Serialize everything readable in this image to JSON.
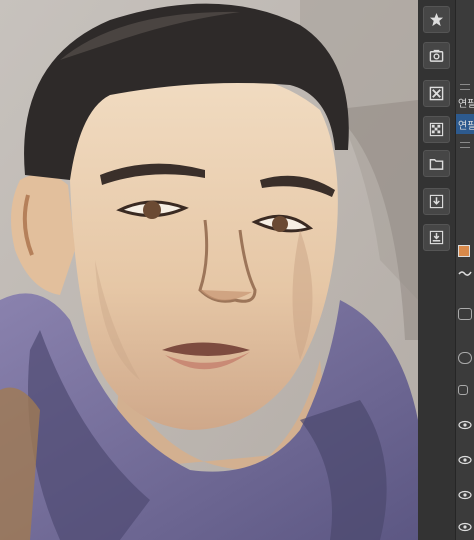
{
  "canvas": {
    "artwork": "portrait-painting"
  },
  "toolstrip": {
    "buttons": [
      {
        "name": "favorite-material-button",
        "icon": "star-icon"
      },
      {
        "name": "camera-material-button",
        "icon": "camera-icon"
      },
      {
        "name": "close-material-button",
        "icon": "close-icon"
      },
      {
        "name": "pattern-material-button",
        "icon": "checker-icon"
      },
      {
        "name": "folder-material-button",
        "icon": "folder-icon"
      },
      {
        "name": "import-material-button",
        "icon": "download-icon"
      },
      {
        "name": "export-material-button",
        "icon": "download-tray-icon"
      }
    ]
  },
  "layer_panel": {
    "item1_label": "연필",
    "item2_label": "연필",
    "swatch_color": "#d8894a",
    "accent_color": "#2d5a8e"
  }
}
